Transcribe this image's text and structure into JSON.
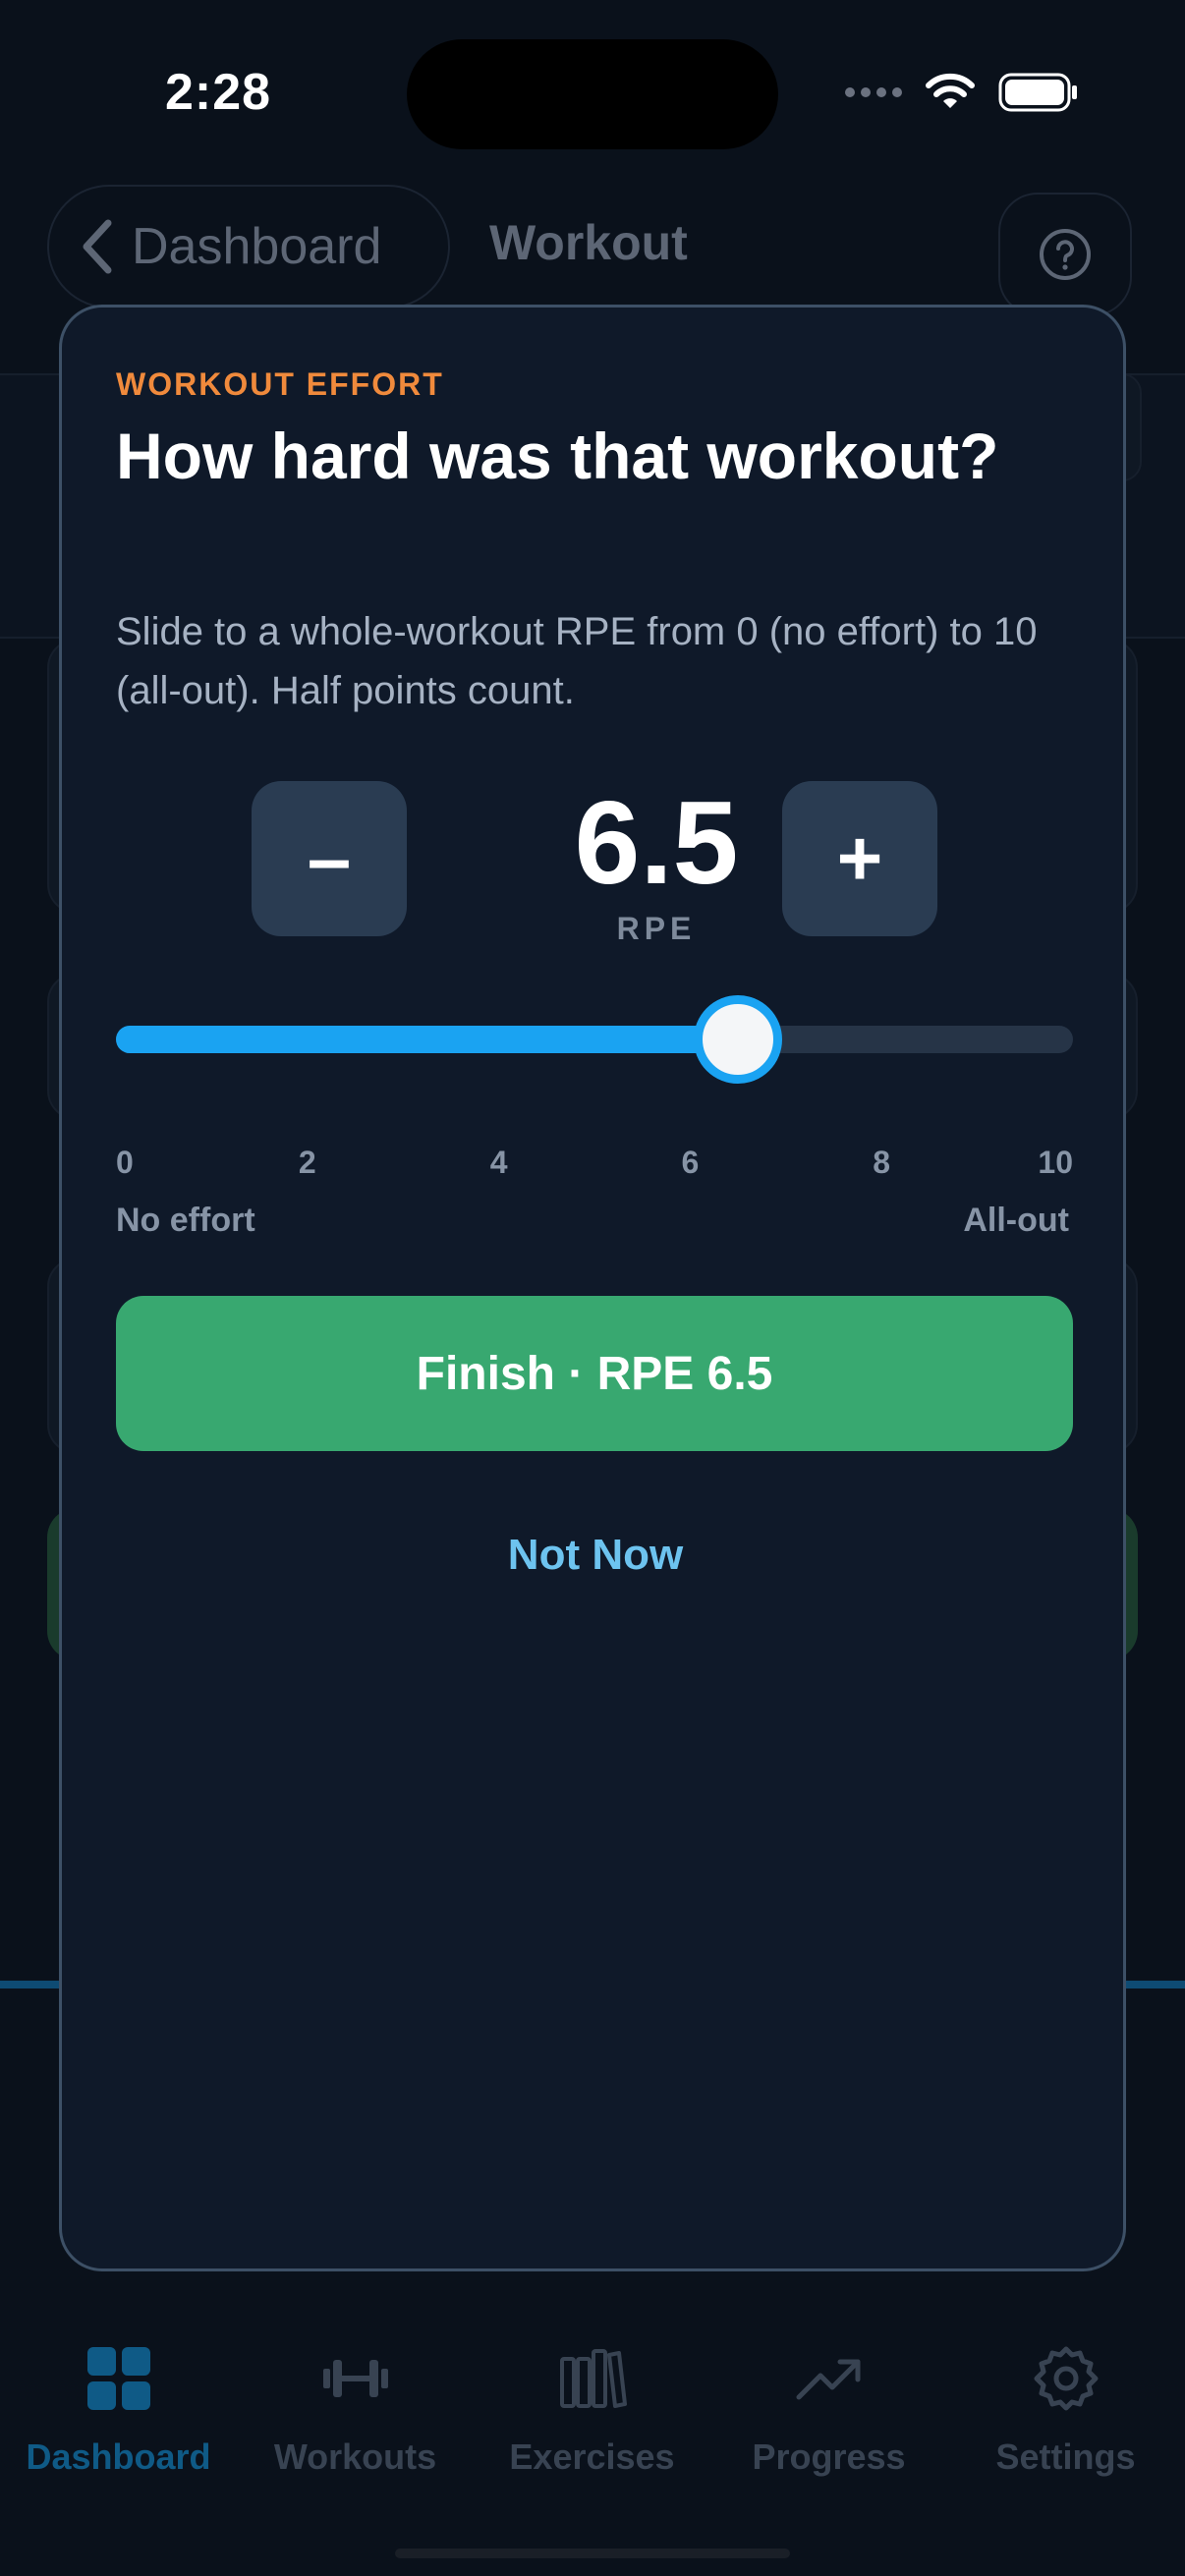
{
  "status_bar": {
    "time": "2:28"
  },
  "nav": {
    "back_label": "Dashboard",
    "title": "Workout"
  },
  "modal": {
    "eyebrow": "WORKOUT EFFORT",
    "title": "How hard was that workout?",
    "subtitle": "Slide to a whole-workout RPE from 0 (no effort) to 10 (all-out). Half points count.",
    "minus_label": "–",
    "plus_label": "+",
    "rpe_value": "6.5",
    "rpe_unit": "RPE",
    "slider": {
      "min": 0,
      "max": 10,
      "value": 6.5,
      "fill_color": "#1aa3f2"
    },
    "ticks": [
      "0",
      "2",
      "4",
      "6",
      "8",
      "10"
    ],
    "min_label": "No effort",
    "max_label": "All-out",
    "finish_label": "Finish · RPE 6.5",
    "not_now_label": "Not Now"
  },
  "tabs": [
    {
      "label": "Dashboard",
      "icon": "dashboard-icon",
      "active": true
    },
    {
      "label": "Workouts",
      "icon": "dumbbell-icon",
      "active": false
    },
    {
      "label": "Exercises",
      "icon": "library-icon",
      "active": false
    },
    {
      "label": "Progress",
      "icon": "trend-icon",
      "active": false
    },
    {
      "label": "Settings",
      "icon": "gear-icon",
      "active": false
    }
  ],
  "colors": {
    "accent_orange": "#f08a3c",
    "accent_blue": "#1aa3f2",
    "finish_green": "#38a870",
    "link_blue": "#6dc3ef",
    "active_tab": "#0f5a86"
  }
}
